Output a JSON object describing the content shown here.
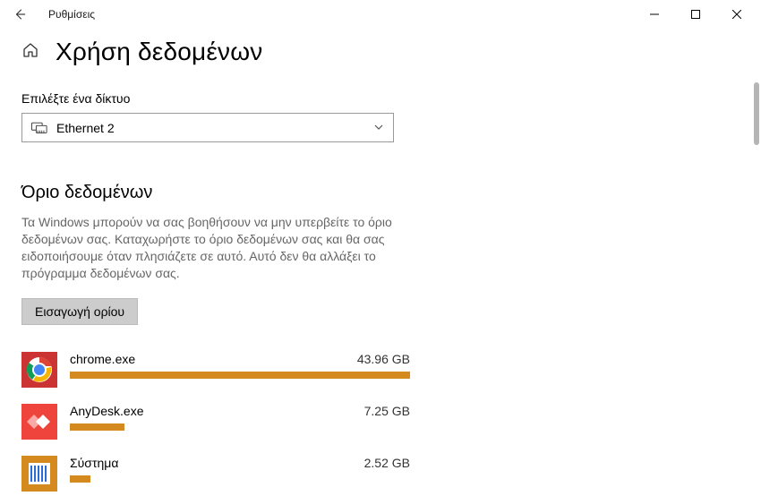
{
  "window": {
    "title": "Ρυθμίσεις"
  },
  "header": {
    "page_title": "Χρήση δεδομένων"
  },
  "network": {
    "label": "Επιλέξτε ένα δίκτυο",
    "selected": "Ethernet 2"
  },
  "data_limit": {
    "section_title": "Όριο δεδομένων",
    "description": "Τα Windows μπορούν να σας βοηθήσουν να μην υπερβείτε το όριο δεδομένων σας. Καταχωρήστε το όριο δεδομένων σας και θα σας ειδοποιήσουμε όταν πλησιάζετε σε αυτό. Αυτό δεν θα αλλάξει το πρόγραμμα δεδομένων σας.",
    "button": "Εισαγωγή ορίου"
  },
  "apps": [
    {
      "name": "chrome.exe",
      "usage": "43.96 GB",
      "pct": 100,
      "icon": "chrome"
    },
    {
      "name": "AnyDesk.exe",
      "usage": "7.25 GB",
      "pct": 16,
      "icon": "anydesk"
    },
    {
      "name": "Σύστημα",
      "usage": "2.52 GB",
      "pct": 6,
      "icon": "system"
    }
  ]
}
